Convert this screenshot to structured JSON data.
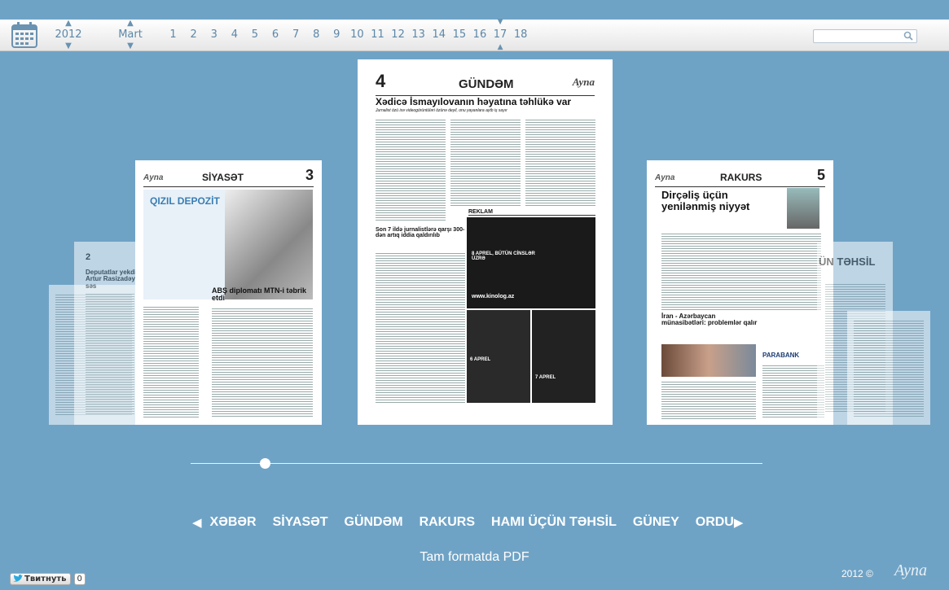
{
  "topbar": {
    "year": "2012",
    "month": "Mart",
    "days": [
      "1",
      "2",
      "3",
      "4",
      "5",
      "6",
      "7",
      "8",
      "9",
      "10",
      "11",
      "12",
      "13",
      "14",
      "15",
      "16",
      "17",
      "18"
    ],
    "selected_day": "17",
    "icons": {
      "calendar": "calendar-icon",
      "search": "search-icon"
    }
  },
  "pages": {
    "left_page": {
      "number": "3",
      "section": "SİYASƏT",
      "ad": "QIZIL DEPOZİT",
      "headline": "ABŞ diplomatı MTN-i təbrik etdi"
    },
    "left_small": {
      "number": "2",
      "headline": "Deputatlar yekdillik Artur Rasizadəyə səs"
    },
    "center_page": {
      "number": "4",
      "section": "GÜNDƏM",
      "brand": "Ayna",
      "headline": "Xədicə İsmayılovanın həyatına təhlükə var",
      "subhead": "Jurnalist özü isə videogörüntüləri özünə deyil, onu yayanlara aytb iş sayır",
      "story2": "Son 7 ildə jurnalistlərə qarşı 300-dən artıq iddia qaldırılıb",
      "reklam": "REKLAM",
      "ad_url": "www.kinolog.az",
      "ad_line1": "8 APREL, BÜTÜN CİNSLƏR ÜZRƏ",
      "ad_line2": "6 APREL",
      "ad_line3": "7 APREL"
    },
    "right_page": {
      "number": "5",
      "section": "RAKURS",
      "headline": "Dirçəliş üçün yenilənmiş niyyət",
      "headline2": "İran - Azərbaycan münasibətləri: problemlər qalır",
      "bank": "PARABANK"
    },
    "right_small": {
      "section": "ÜN TƏHSİL"
    }
  },
  "slider": {
    "position_fraction": 0.13
  },
  "sections": {
    "items": [
      "XƏBƏR",
      "SİYASƏT",
      "GÜNDƏM",
      "RAKURS",
      "HAMI ÜÇÜN TƏHSİL",
      "GÜNEY",
      "ORDU"
    ]
  },
  "pdf_label": "Tam formatda PDF",
  "tweet": {
    "label": "Твитнуть",
    "count": "0"
  },
  "footer": {
    "copyright": "2012 ©",
    "logo": "Ayna"
  },
  "colors": {
    "background": "#6fa3c6",
    "accent": "#5c87a8",
    "text": "#ffffff"
  }
}
